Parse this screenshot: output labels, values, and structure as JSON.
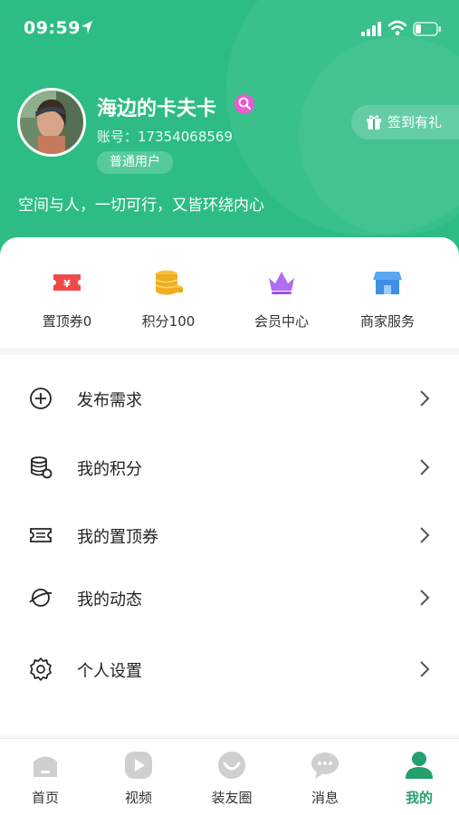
{
  "status_bar": {
    "time": "09:59"
  },
  "profile": {
    "name": "海边的卡夫卡",
    "account_label": "账号：",
    "account_number": "17354068569",
    "user_type": "普通用户",
    "signin_label": "签到有礼",
    "slogan": "空间与人，一切可行，又皆环绕内心"
  },
  "quick_actions": [
    {
      "label": "置顶券0",
      "icon": "ticket-icon"
    },
    {
      "label": "积分100",
      "icon": "coins-icon"
    },
    {
      "label": "会员中心",
      "icon": "crown-icon"
    },
    {
      "label": "商家服务",
      "icon": "shop-icon"
    }
  ],
  "menu": [
    {
      "label": "发布需求",
      "icon": "plus-circle-icon"
    },
    {
      "label": "我的积分",
      "icon": "coin-stack-icon"
    },
    {
      "label": "我的置顶券",
      "icon": "ticket-outline-icon"
    },
    {
      "label": "我的动态",
      "icon": "planet-icon"
    },
    {
      "label": "个人设置",
      "icon": "gear-icon"
    }
  ],
  "tabs": [
    {
      "label": "首页",
      "icon": "home-icon",
      "active": false
    },
    {
      "label": "视频",
      "icon": "play-icon",
      "active": false
    },
    {
      "label": "装友圈",
      "icon": "smile-icon",
      "active": false
    },
    {
      "label": "消息",
      "icon": "chat-icon",
      "active": false
    },
    {
      "label": "我的",
      "icon": "user-icon",
      "active": true
    }
  ],
  "colors": {
    "brand": "#2dbd84",
    "active_tab": "#23a06e"
  }
}
